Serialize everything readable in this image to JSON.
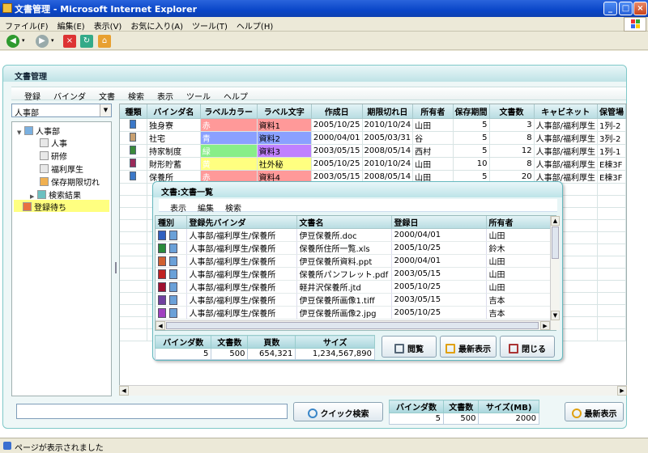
{
  "window": {
    "title": "文書管理 - Microsoft Internet Explorer"
  },
  "ie_menu": [
    "ファイル(F)",
    "編集(E)",
    "表示(V)",
    "お気に入り(A)",
    "ツール(T)",
    "ヘルプ(H)"
  ],
  "ie_toolbar_icons": [
    "back-icon",
    "forward-icon",
    "stop-icon",
    "refresh-icon",
    "home-icon"
  ],
  "app": {
    "title": "文書管理",
    "menu": [
      "登録",
      "バインダ",
      "文書",
      "検索",
      "表示",
      "ツール",
      "ヘルプ"
    ],
    "dept_select": "人事部",
    "tree": [
      {
        "label": "人事部",
        "icon": "department-icon"
      },
      {
        "label": "人事",
        "icon": "binder-icon"
      },
      {
        "label": "研修",
        "icon": "binder-icon"
      },
      {
        "label": "福利厚生",
        "icon": "binder-icon"
      },
      {
        "label": "保存期限切れ",
        "icon": "expired-icon"
      },
      {
        "label": "検索結果",
        "icon": "search-result-icon"
      },
      {
        "label": "登録待ち",
        "icon": "pending-icon"
      }
    ],
    "grid": {
      "columns": [
        "種類",
        "バインダ名",
        "ラベルカラー",
        "ラベル文字",
        "作成日",
        "期限切れ日",
        "所有者",
        "保存期間",
        "文書数",
        "キャビネット",
        "保管場"
      ],
      "rows": [
        {
          "name": "独身寮",
          "color_label": "赤",
          "color": "#ff9999",
          "label_text": "資料1",
          "label_bg": "#ff9999",
          "created": "2005/10/25",
          "expires": "2010/10/24",
          "owner": "山田",
          "period": "5",
          "docs": "3",
          "cabinet": "人事部/福利厚生",
          "location": "1列-2",
          "icon_color": "#3b78c8"
        },
        {
          "name": "社宅",
          "color_label": "青",
          "color": "#8aa0ff",
          "label_text": "資料2",
          "label_bg": "#8aa0ff",
          "created": "2000/04/01",
          "expires": "2005/03/31",
          "owner": "谷",
          "period": "5",
          "docs": "8",
          "cabinet": "人事部/福利厚生",
          "location": "3列-2",
          "icon_color": "#c8a070"
        },
        {
          "name": "持家制度",
          "color_label": "緑",
          "color": "#88ee88",
          "label_text": "資料3",
          "label_bg": "#c080ff",
          "created": "2003/05/15",
          "expires": "2008/05/14",
          "owner": "西村",
          "period": "5",
          "docs": "12",
          "cabinet": "人事部/福利厚生",
          "location": "1列-1",
          "icon_color": "#3a8a3a"
        },
        {
          "name": "財形貯蓄",
          "color_label": "黄",
          "color": "#ffff80",
          "label_text": "社外秘",
          "label_bg": "#ffff80",
          "created": "2005/10/25",
          "expires": "2010/10/24",
          "owner": "山田",
          "period": "10",
          "docs": "8",
          "cabinet": "人事部/福利厚生",
          "location": "E棟3F",
          "icon_color": "#9a2a5a"
        },
        {
          "name": "保養所",
          "color_label": "赤",
          "color": "#ff9999",
          "label_text": "資料4",
          "label_bg": "#ff9999",
          "created": "2003/05/15",
          "expires": "2008/05/14",
          "owner": "山田",
          "period": "5",
          "docs": "20",
          "cabinet": "人事部/福利厚生",
          "location": "E棟3F",
          "icon_color": "#3b78c8"
        }
      ]
    },
    "bottom": {
      "quick_search_button": "クイック検索",
      "summary_headers": [
        "バインダ数",
        "文書数",
        "サイズ(MB)"
      ],
      "summary_values": [
        "5",
        "500",
        "2000"
      ],
      "refresh_button": "最新表示"
    }
  },
  "popup": {
    "title": "文書:文書一覧",
    "menu": [
      "表示",
      "編集",
      "検索"
    ],
    "columns": [
      "種別",
      "登録先バインダ",
      "文書名",
      "登録日",
      "所有者"
    ],
    "rows": [
      {
        "icon": "word-icon",
        "color": "#3060c0",
        "binder": "人事部/福利厚生/保養所",
        "doc": "伊豆保養所.doc",
        "date": "2000/04/01",
        "owner": "山田"
      },
      {
        "icon": "excel-icon",
        "color": "#2a8a3a",
        "binder": "人事部/福利厚生/保養所",
        "doc": "保養所住所一覧.xls",
        "date": "2005/10/25",
        "owner": "鈴木"
      },
      {
        "icon": "powerpoint-icon",
        "color": "#d06030",
        "binder": "人事部/福利厚生/保養所",
        "doc": "伊豆保養所資料.ppt",
        "date": "2000/04/01",
        "owner": "山田"
      },
      {
        "icon": "pdf-icon",
        "color": "#c02020",
        "binder": "人事部/福利厚生/保養所",
        "doc": "保養所パンフレット.pdf",
        "date": "2003/05/15",
        "owner": "山田"
      },
      {
        "icon": "jtd-icon",
        "color": "#a01030",
        "binder": "人事部/福利厚生/保養所",
        "doc": "軽井沢保養所.jtd",
        "date": "2005/10/25",
        "owner": "山田"
      },
      {
        "icon": "tiff-icon",
        "color": "#7040a0",
        "binder": "人事部/福利厚生/保養所",
        "doc": "伊豆保養所画像1.tiff",
        "date": "2003/05/15",
        "owner": "吉本"
      },
      {
        "icon": "jpg-icon",
        "color": "#a040c0",
        "binder": "人事部/福利厚生/保養所",
        "doc": "伊豆保養所画像2.jpg",
        "date": "2005/10/25",
        "owner": "吉本"
      }
    ],
    "summary_headers": [
      "バインダ数",
      "文書数",
      "頁数",
      "サイズ"
    ],
    "summary_values": [
      "5",
      "500",
      "654,321",
      "1,234,567,890"
    ],
    "buttons": {
      "view": "閲覧",
      "refresh": "最新表示",
      "close": "閉じる"
    }
  },
  "status": "ページが表示されました"
}
